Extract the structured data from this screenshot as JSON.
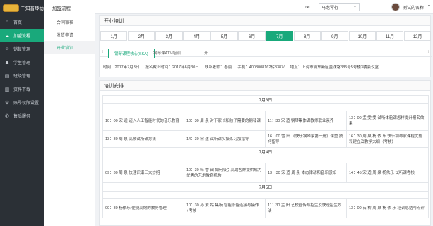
{
  "app": {
    "logo_text": "千知音琴坊"
  },
  "sidebar": {
    "items": [
      {
        "label": "首页",
        "icon": "home-icon",
        "glyph": "⌂",
        "active": false
      },
      {
        "label": "加盟流程",
        "icon": "cloud-icon",
        "glyph": "☁",
        "active": true
      },
      {
        "label": "销售管理",
        "icon": "user-icon",
        "glyph": "☺",
        "active": false
      },
      {
        "label": "学生管理",
        "icon": "student-icon",
        "glyph": "♟",
        "active": false
      },
      {
        "label": "班级管理",
        "icon": "class-icon",
        "glyph": "▤",
        "active": false
      },
      {
        "label": "资料下载",
        "icon": "book-icon",
        "glyph": "▥",
        "active": false
      },
      {
        "label": "账号权限设置",
        "icon": "settings-icon",
        "glyph": "⚙",
        "active": false
      },
      {
        "label": "售后服务",
        "icon": "service-icon",
        "glyph": "✆",
        "active": false
      }
    ]
  },
  "submenu": {
    "title": "加盟流程",
    "items": [
      {
        "label": "合同审核",
        "active": false
      },
      {
        "label": "发货申请",
        "active": false
      },
      {
        "label": "开业培训",
        "active": true
      }
    ]
  },
  "topbar": {
    "org_selected": "马龙琴行",
    "user_name": "测试的名称"
  },
  "training": {
    "title": "开业培训",
    "months": [
      "1月",
      "2月",
      "3月",
      "4月",
      "5月",
      "6月",
      "7月",
      "8月",
      "9月",
      "10月",
      "11月",
      "12月"
    ],
    "active_month_index": 6,
    "tabs": [
      "钢琴课程核心(SSA)",
      "钢琴课ATM培训",
      "开"
    ],
    "info": {
      "time": "时间：2017年7月3日",
      "deadline": "报名截止时间：2017年6月30日",
      "contact": "联系老师：春丽",
      "phone": "手机：4008008162转8387/",
      "address": "地点：上海市浦东新区金沈路385号5号楼3楼会议室"
    }
  },
  "schedule": {
    "title": "培训安排",
    "days": [
      {
        "date": "7月3日",
        "rows": [
          [
            "10：00 宋 适 迈入人工智能时代的音乐教育",
            "10：30 周 泉 对下家长和孩子需要的钢琴课",
            "11：30 宋 适 钢琴集体课教师职业素养",
            "13：00 孟 雯 雯 试听体验课怎样提升报名效果"
          ],
          [
            "13：30 周 泉 高效试听课方法",
            "14：30 宋 适 试听课实操练习加指导",
            "16：00 雪 田 《快乐钢琴家第一册》课重 技巧指导",
            "16：30 周 泉 杨 依 乐 快乐钢琴家课程优势和建立及教学大纲（考核）"
          ]
        ]
      },
      {
        "date": "7月4日",
        "rows": [
          [
            "09：30 周 泉 快速识谱三大妙招",
            "10：30 吗 雪 田 如何吸引高端客群提供成为优秀的艺术教育机构",
            "13：30 宋 适 周 泉 体态律动和音乐感知",
            "14：45 宋 适 周 泉 杨依乐 试听课考核"
          ]
        ]
      },
      {
        "date": "7月5日",
        "rows": [
          [
            "09：30 杨依乐 便捷高效的教务管理",
            "10：30 孙 爱 姑 集板 智能设备连接与操作 +考核",
            "11：30 孟 田 艺校宣传与招生及快速招生方法",
            "13：00 石 桥 周 泉 杨 依 乐 培训总结与点评"
          ]
        ]
      }
    ]
  }
}
